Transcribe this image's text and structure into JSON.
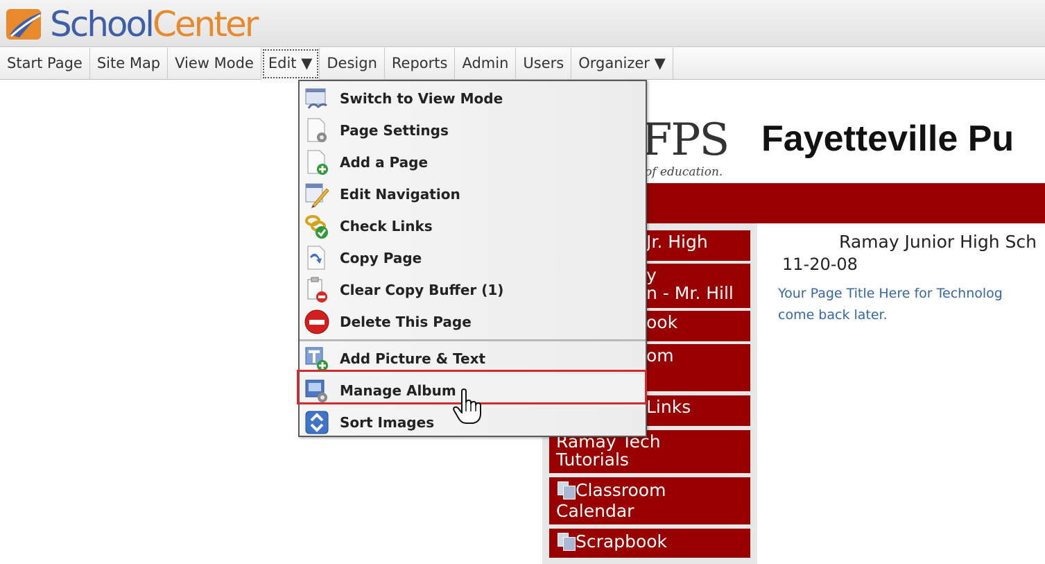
{
  "app": {
    "logo_school": "School",
    "logo_center": "Center",
    "colors": {
      "logo_blue": "#3e5fa8",
      "logo_orange": "#e8892b",
      "nav_red": "#990000",
      "highlight": "#d12b2b"
    }
  },
  "menubar": {
    "items": [
      {
        "label": "Start Page"
      },
      {
        "label": "Site Map"
      },
      {
        "label": "View Mode"
      },
      {
        "label": "Edit ▼"
      },
      {
        "label": "Design"
      },
      {
        "label": "Reports"
      },
      {
        "label": "Admin"
      },
      {
        "label": "Users"
      },
      {
        "label": "Organizer ▼"
      }
    ]
  },
  "edit_menu": {
    "items": [
      {
        "label": "Switch to View Mode",
        "icon": "view-mode-icon"
      },
      {
        "label": "Page Settings",
        "icon": "page-settings-icon"
      },
      {
        "label": "Add a Page",
        "icon": "add-page-icon"
      },
      {
        "label": "Edit Navigation",
        "icon": "edit-navigation-icon"
      },
      {
        "label": "Check Links",
        "icon": "check-links-icon"
      },
      {
        "label": "Copy Page",
        "icon": "copy-page-icon"
      },
      {
        "label": "Clear Copy Buffer (1)",
        "icon": "clear-buffer-icon"
      },
      {
        "label": "Delete This Page",
        "icon": "delete-icon"
      },
      {
        "label": "Add Picture & Text",
        "icon": "add-picture-icon"
      },
      {
        "label": "Manage Album",
        "icon": "manage-album-icon",
        "highlighted": true
      },
      {
        "label": "Sort Images",
        "icon": "sort-icon"
      }
    ]
  },
  "page": {
    "district_logo": "FPS",
    "tagline": "of education.",
    "title": "Fayetteville Pu",
    "main_heading": "Ramay Junior High Sch",
    "date": "11-20-08",
    "note_line1": "Your Page Title Here for Technolog",
    "note_line2": "come back later."
  },
  "left_nav": {
    "items": [
      {
        "label": "Jr. High"
      },
      {
        "line1": "y",
        "line2": "n - Mr. Hill"
      },
      {
        "label": "ook"
      },
      {
        "label": "om"
      },
      {
        "label": "Links"
      },
      {
        "line1": "Ramay Tech",
        "line2": "Tutorials"
      },
      {
        "line1": "Classroom",
        "line2": "Calendar"
      },
      {
        "label": "Scrapbook"
      }
    ]
  }
}
